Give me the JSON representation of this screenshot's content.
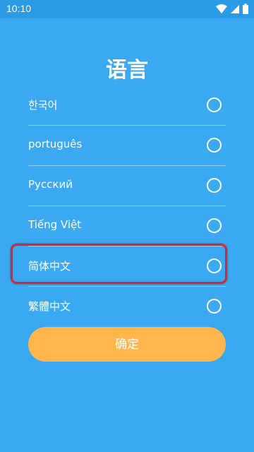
{
  "status_bar": {
    "time": "10:10"
  },
  "title": "语言",
  "languages": [
    {
      "label": "한국어",
      "selected": false
    },
    {
      "label": "português",
      "selected": false
    },
    {
      "label": "Русский",
      "selected": false
    },
    {
      "label": "Tiếng Việt",
      "selected": false
    },
    {
      "label": "简体中文",
      "selected": false
    },
    {
      "label": "繁體中文",
      "selected": false
    }
  ],
  "confirm_label": "确定",
  "colors": {
    "background": "#3aa9f1",
    "button": "#ffb74d",
    "highlight": "#d8282e"
  }
}
